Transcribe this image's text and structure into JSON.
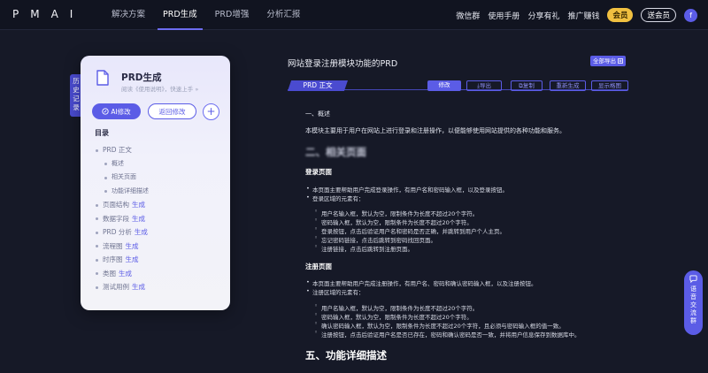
{
  "brand": {
    "logo": "PMAI"
  },
  "nav": {
    "items": [
      "解决方案",
      "PRD生成",
      "PRD增强",
      "分析汇报"
    ],
    "active_index": 1,
    "right": [
      "微信群",
      "使用手册",
      "分享有礼",
      "推广赚钱"
    ],
    "vip_label": "会员",
    "gift_label": "送会员",
    "avatar_letter": "f"
  },
  "history_tab": "历史记录",
  "sidebar": {
    "title": "PRD生成",
    "subtitle": "阅读《使用说明》，快速上手 »",
    "ai_edit": "AI修改",
    "back_edit": "返回修改",
    "plus": "+",
    "toc_title": "目录",
    "gen_label": "生成",
    "toc": [
      {
        "label": "PRD 正文",
        "level": 1,
        "gen": false
      },
      {
        "label": "概述",
        "level": 2,
        "gen": false
      },
      {
        "label": "相关页面",
        "level": 2,
        "gen": false
      },
      {
        "label": "功能详细描述",
        "level": 2,
        "gen": false
      },
      {
        "label": "页面结构",
        "level": 1,
        "gen": true
      },
      {
        "label": "数据字段",
        "level": 1,
        "gen": true
      },
      {
        "label": "PRD 分析",
        "level": 1,
        "gen": true
      },
      {
        "label": "流程图",
        "level": 1,
        "gen": true
      },
      {
        "label": "时序图",
        "level": 1,
        "gen": true
      },
      {
        "label": "类图",
        "level": 1,
        "gen": true
      },
      {
        "label": "测试用例",
        "level": 1,
        "gen": true
      }
    ]
  },
  "document": {
    "title": "网站登录注册模块功能的PRD",
    "export_all": "全部导出",
    "tab": "PRD 正文",
    "tools": [
      "修改",
      "导出",
      "复制",
      "重新生成",
      "显示格图"
    ],
    "section1": "一、概述",
    "overview": "本模块主要用于用户在网站上进行登录和注册操作，以便能够使用网站提供的各种功能和服务。",
    "section2": "二、相关页面",
    "login_page": "登录页面",
    "login_points": [
      "本页面主要帮助用户完成登录操作，有用户名和密码输入框，以及登录按钮。",
      "登录区域的元素有："
    ],
    "login_elements": [
      "用户名输入框，默认为空，限制条件为长度不超过20个字符。",
      "密码输入框，默认为空，限制条件为长度不超过20个字符。",
      "登录按钮，点击后验证用户名和密码是否正确，并跳转到用户个人主页。",
      "忘记密码链接，点击后跳转到密码找回页面。",
      "注册链接，点击后跳转到注册页面。"
    ],
    "register_page": "注册页面",
    "register_points": [
      "本页面主要帮助用户完成注册操作，有用户名、密码和确认密码输入框，以及注册按钮。",
      "注册区域的元素有："
    ],
    "register_elements": [
      "用户名输入框，默认为空，限制条件为长度不超过20个字符。",
      "密码输入框，默认为空，限制条件为长度不超过20个字符。",
      "确认密码输入框，默认为空，限制条件为长度不超过20个字符，且必须与密码输入框的值一致。",
      "注册按钮，点击后验证用户名是否已存在，密码和确认密码是否一致，并将用户信息保存到数据库中。"
    ],
    "section5": "五、功能详细描述"
  },
  "voice_group": "语音交流群",
  "colors": {
    "accent": "#5b5ce6",
    "background": "#161927",
    "vip": "#f0c040"
  }
}
